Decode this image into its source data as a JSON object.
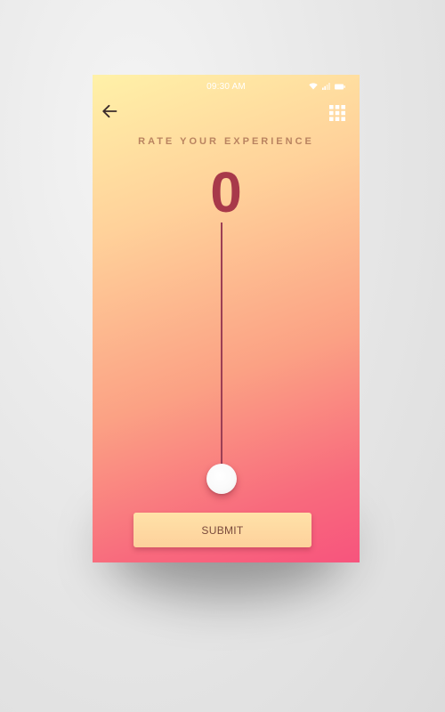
{
  "status_bar": {
    "time": "09:30 AM",
    "icons": [
      "wifi-icon",
      "signal-icon",
      "battery-icon"
    ]
  },
  "header": {
    "back_icon": "arrow-left-icon",
    "apps_icon": "grid-icon"
  },
  "rating": {
    "heading": "RATE YOUR EXPERIENCE",
    "value": "0",
    "slider_level": 0
  },
  "actions": {
    "submit_label": "SUBMIT"
  },
  "colors": {
    "gradient_top": "#fff1a8",
    "gradient_bottom": "#f7547d",
    "accent": "#a8394a",
    "heading": "#b98360",
    "button": "#fdd19c"
  }
}
